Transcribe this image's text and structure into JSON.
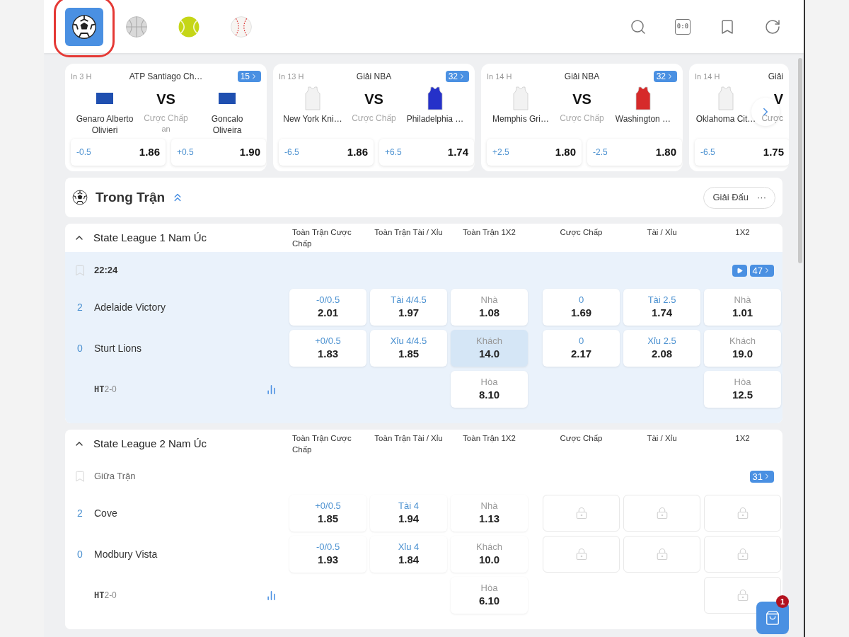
{
  "sports": [
    {
      "kind": "soccer",
      "selected": true
    },
    {
      "kind": "basketball",
      "selected": false
    },
    {
      "kind": "tennis",
      "selected": false
    },
    {
      "kind": "baseball",
      "selected": false
    }
  ],
  "toolbar": {
    "scoreboard_label": "0:0"
  },
  "featured": [
    {
      "time": "In 3 H",
      "league": "ATP Santiago Ch…",
      "count": "15",
      "cut": false,
      "home": {
        "name": "Genaro Alberto Olivieri",
        "kind": "flag",
        "color": "#1f4fb0"
      },
      "vs": "VS",
      "market": "Cược Chấp",
      "note": "an",
      "away": {
        "name": "Goncalo Oliveira",
        "kind": "flag",
        "color": "#1f4fb0"
      },
      "odds": [
        {
          "line": "-0.5",
          "price": "1.86"
        },
        {
          "line": "+0.5",
          "price": "1.90"
        }
      ]
    },
    {
      "time": "In 13 H",
      "league": "Giải NBA",
      "count": "32",
      "cut": false,
      "home": {
        "name": "New York Kni…",
        "kind": "jersey",
        "color": "#f2f2f2"
      },
      "vs": "VS",
      "market": "Cược Chấp",
      "away": {
        "name": "Philadelphia …",
        "kind": "jersey",
        "color": "#2531c9"
      },
      "odds": [
        {
          "line": "-6.5",
          "price": "1.86"
        },
        {
          "line": "+6.5",
          "price": "1.74"
        }
      ]
    },
    {
      "time": "In 14 H",
      "league": "Giải NBA",
      "count": "32",
      "cut": false,
      "home": {
        "name": "Memphis Gri…",
        "kind": "jersey",
        "color": "#f2f2f2"
      },
      "vs": "VS",
      "market": "Cược Chấp",
      "away": {
        "name": "Washington …",
        "kind": "jersey",
        "color": "#d62a2a"
      },
      "odds": [
        {
          "line": "+2.5",
          "price": "1.80"
        },
        {
          "line": "-2.5",
          "price": "1.80"
        }
      ]
    },
    {
      "time": "In 14 H",
      "league": "Giải",
      "cut": true,
      "home": {
        "name": "Oklahoma Cit…",
        "kind": "jersey",
        "color": "#f2f2f2"
      },
      "vs": "V",
      "market": "Cược",
      "odds": [
        {
          "line": "-6.5",
          "price": "1.75"
        }
      ]
    }
  ],
  "section": {
    "title": "Trong Trận",
    "expanded": true,
    "filter_button": "Giải Đấu",
    "more": "···"
  },
  "leagues": [
    {
      "name": "State League 1 Nam Úc",
      "expanded": true,
      "columns": [
        "Toàn Trận Cược Chấp",
        "Toàn Trận Tài / Xỉu",
        "Toàn Trận 1X2",
        "Cược Chấp",
        "Tài / Xỉu",
        "1X2"
      ],
      "matches": [
        {
          "status": {
            "kind": "clock",
            "text": "22:24"
          },
          "bookmarked": false,
          "live_stream": true,
          "count": "47",
          "highlighted": true,
          "teams": [
            {
              "score": "2",
              "name": "Adelaide Victory"
            },
            {
              "score": "0",
              "name": "Sturt Lions"
            }
          ],
          "halftime": {
            "label": "HT",
            "score": "2-0"
          },
          "rows": [
            [
              {
                "kind": "line",
                "label": "-0/0.5",
                "price": "2.01",
                "selected": false
              },
              {
                "kind": "line",
                "label": "Tài 4/4.5",
                "price": "1.97",
                "selected": false
              },
              {
                "kind": "outcome",
                "label": "Nhà",
                "price": "1.08",
                "selected": false
              },
              {
                "kind": "line",
                "label": "0",
                "price": "1.69",
                "selected": false
              },
              {
                "kind": "line",
                "label": "Tài 2.5",
                "price": "1.74",
                "selected": false
              },
              {
                "kind": "outcome",
                "label": "Nhà",
                "price": "1.01",
                "selected": false
              }
            ],
            [
              {
                "kind": "line",
                "label": "+0/0.5",
                "price": "1.83",
                "selected": false
              },
              {
                "kind": "line",
                "label": "Xỉu 4/4.5",
                "price": "1.85",
                "selected": false
              },
              {
                "kind": "outcome",
                "label": "Khách",
                "price": "14.0",
                "selected": true
              },
              {
                "kind": "line",
                "label": "0",
                "price": "2.17",
                "selected": false
              },
              {
                "kind": "line",
                "label": "Xỉu 2.5",
                "price": "2.08",
                "selected": false
              },
              {
                "kind": "outcome",
                "label": "Khách",
                "price": "19.0",
                "selected": false
              }
            ],
            [
              {
                "kind": "empty"
              },
              {
                "kind": "empty"
              },
              {
                "kind": "outcome",
                "label": "Hòa",
                "price": "8.10",
                "selected": false
              },
              {
                "kind": "empty"
              },
              {
                "kind": "empty"
              },
              {
                "kind": "outcome",
                "label": "Hòa",
                "price": "12.5",
                "selected": false
              }
            ]
          ]
        }
      ]
    },
    {
      "name": "State League 2 Nam Úc",
      "expanded": true,
      "columns": [
        "Toàn Trận Cược Chấp",
        "Toàn Trận Tài / Xỉu",
        "Toàn Trận 1X2",
        "Cược Chấp",
        "Tài / Xỉu",
        "1X2"
      ],
      "matches": [
        {
          "status": {
            "kind": "phase",
            "text": "Giữa Trận"
          },
          "bookmarked": false,
          "live_stream": false,
          "count": "31",
          "highlighted": false,
          "teams": [
            {
              "score": "2",
              "name": "Cove"
            },
            {
              "score": "0",
              "name": "Modbury Vista"
            }
          ],
          "halftime": {
            "label": "HT",
            "score": "2-0"
          },
          "rows": [
            [
              {
                "kind": "line",
                "label": "+0/0.5",
                "price": "1.85",
                "selected": false
              },
              {
                "kind": "line",
                "label": "Tài 4",
                "price": "1.94",
                "selected": false
              },
              {
                "kind": "outcome",
                "label": "Nhà",
                "price": "1.13",
                "selected": false
              },
              {
                "kind": "locked"
              },
              {
                "kind": "locked"
              },
              {
                "kind": "locked"
              }
            ],
            [
              {
                "kind": "line",
                "label": "-0/0.5",
                "price": "1.93",
                "selected": false
              },
              {
                "kind": "line",
                "label": "Xỉu 4",
                "price": "1.84",
                "selected": false
              },
              {
                "kind": "outcome",
                "label": "Khách",
                "price": "10.0",
                "selected": false
              },
              {
                "kind": "locked"
              },
              {
                "kind": "locked"
              },
              {
                "kind": "locked"
              }
            ],
            [
              {
                "kind": "empty"
              },
              {
                "kind": "empty"
              },
              {
                "kind": "outcome",
                "label": "Hòa",
                "price": "6.10",
                "selected": false
              },
              {
                "kind": "empty"
              },
              {
                "kind": "empty"
              },
              {
                "kind": "locked"
              }
            ]
          ]
        }
      ]
    }
  ],
  "cart": {
    "count": "1"
  }
}
